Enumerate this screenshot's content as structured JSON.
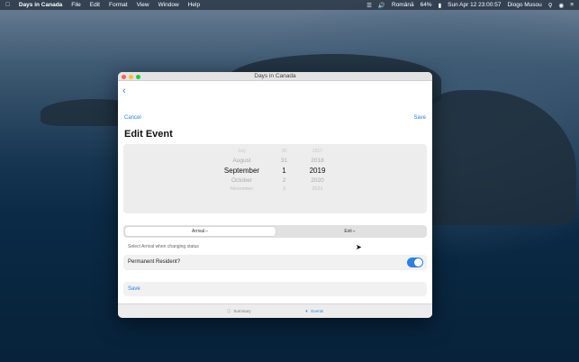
{
  "menubar": {
    "app": "Days in Canada",
    "items": [
      "File",
      "Edit",
      "Format",
      "View",
      "Window",
      "Help"
    ],
    "right": {
      "battery": "64%",
      "input": "Română",
      "datetime": "Sun Apr 12  23:00:57",
      "user": "Diogo Musou"
    }
  },
  "window": {
    "title": "Days in Canada",
    "cancel": "Cancel",
    "save_top": "Save",
    "heading": "Edit Event",
    "picker": {
      "top_fade": {
        "month": "July",
        "day": "30",
        "year": "2017"
      },
      "above": {
        "month": "August",
        "day": "31",
        "year": "2018"
      },
      "selected": {
        "month": "September",
        "day": "1",
        "year": "2019"
      },
      "below1": {
        "month": "October",
        "day": "2",
        "year": "2020"
      },
      "below2": {
        "month": "November",
        "day": "3",
        "year": "2021"
      }
    },
    "segmented": {
      "arrival": "Arrival ⌐",
      "exit": "Exit ⌐"
    },
    "hint": "Select Arrival when changing status",
    "resident_label": "Permanent Resident?",
    "save_row": "Save",
    "tabs": {
      "summary": "Summary",
      "events": "Events"
    }
  }
}
